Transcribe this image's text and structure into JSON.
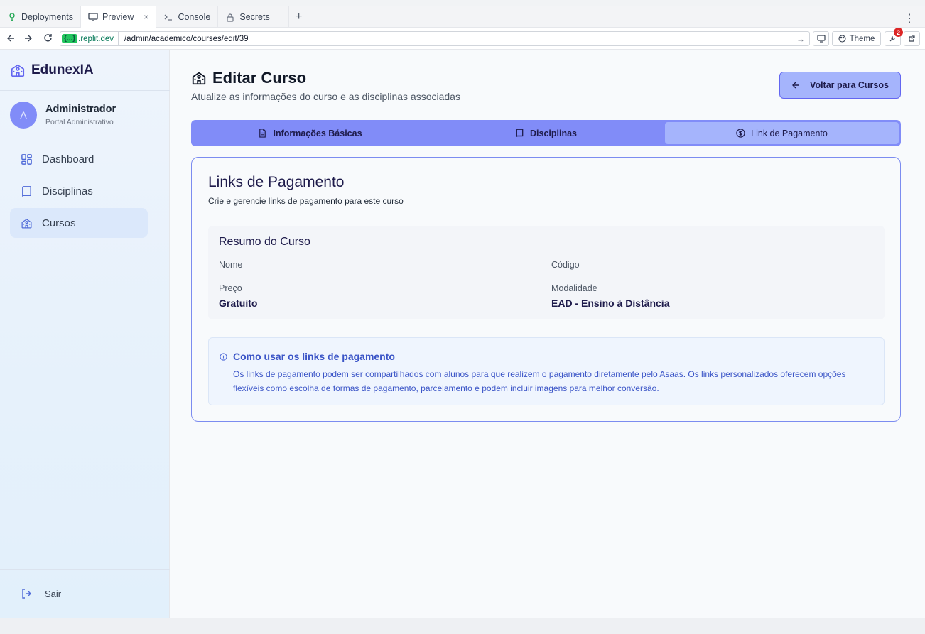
{
  "browser": {
    "tabs": [
      {
        "label": "Deployments",
        "icon": "deploy-icon"
      },
      {
        "label": "Preview",
        "icon": "monitor-icon"
      },
      {
        "label": "Console",
        "icon": "terminal-icon"
      },
      {
        "label": "Secrets",
        "icon": "lock-icon"
      }
    ],
    "close_glyph": "×",
    "new_tab_glyph": "+",
    "menu_glyph": "⋮",
    "domain_pill": "{...}",
    "domain": ".replit.dev",
    "path": "/admin/academico/courses/edit/39",
    "theme_label": "Theme",
    "notification_count": "2"
  },
  "sidebar": {
    "brand": "EdunexIA",
    "user": {
      "initial": "A",
      "name": "Administrador",
      "role": "Portal Administrativo"
    },
    "items": [
      {
        "label": "Dashboard",
        "icon": "dashboard-icon"
      },
      {
        "label": "Disciplinas",
        "icon": "book-icon"
      },
      {
        "label": "Cursos",
        "icon": "school-icon",
        "active": true
      }
    ],
    "logout_label": "Sair"
  },
  "header": {
    "title": "Editar Curso",
    "subtitle": "Atualize as informações do curso e as disciplinas associadas",
    "back_button": "Voltar para Cursos"
  },
  "tabs": [
    {
      "label": "Informações Básicas",
      "icon": "file-text-icon"
    },
    {
      "label": "Disciplinas",
      "icon": "book-icon"
    },
    {
      "label": "Link de Pagamento",
      "icon": "dollar-circle-icon",
      "active": true
    }
  ],
  "card": {
    "title": "Links de Pagamento",
    "subtitle": "Crie e gerencie links de pagamento para este curso",
    "summary": {
      "title": "Resumo do Curso",
      "fields": {
        "nome": {
          "label": "Nome",
          "value": ""
        },
        "codigo": {
          "label": "Código",
          "value": ""
        },
        "preco": {
          "label": "Preço",
          "value": "Gratuito"
        },
        "modalidade": {
          "label": "Modalidade",
          "value": "EAD - Ensino à Distância"
        }
      }
    },
    "info": {
      "title": "Como usar os links de pagamento",
      "text": "Os links de pagamento podem ser compartilhados com alunos para que realizem o pagamento diretamente pelo Asaas. Os links personalizados oferecem opções flexíveis como escolha de formas de pagamento, parcelamento e podem incluir imagens para melhor conversão."
    }
  },
  "colors": {
    "accent": "#818cf8",
    "accent_light": "#a5b4fc",
    "info_text": "#3b55c7"
  }
}
